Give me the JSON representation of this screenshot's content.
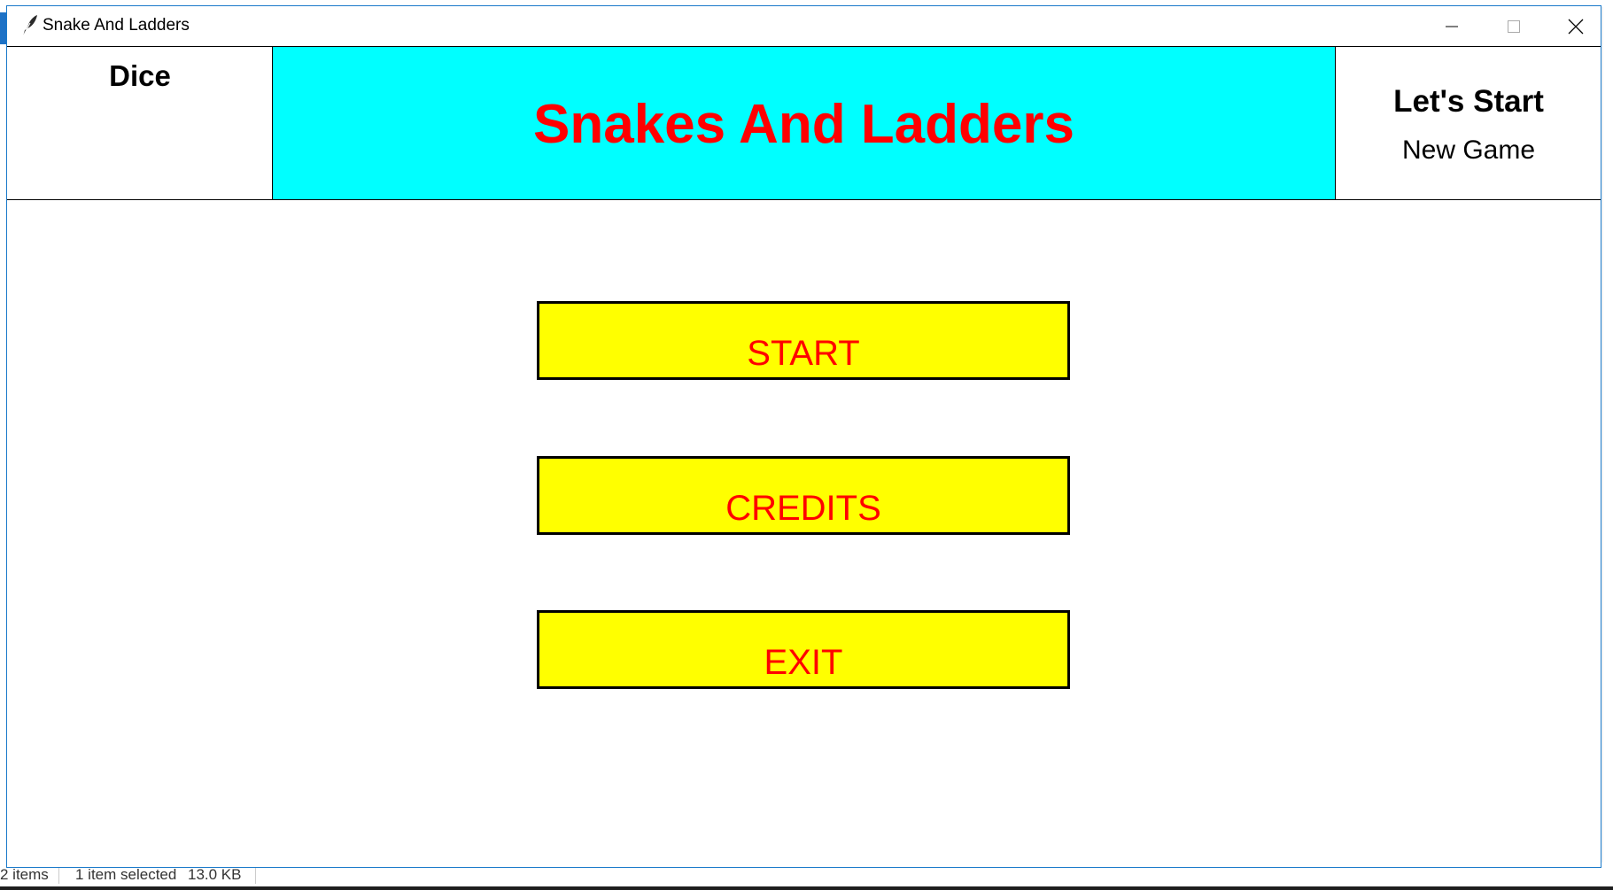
{
  "window": {
    "title": "Snake And Ladders"
  },
  "header": {
    "dice_label": "Dice",
    "game_title": "Snakes And Ladders",
    "lets_start": "Let's Start",
    "new_game": "New Game"
  },
  "menu": {
    "start_label": "START",
    "credits_label": "CREDITS",
    "exit_label": "EXIT"
  },
  "statusbar": {
    "items": "2 items",
    "selected": "1 item selected",
    "size": "13.0 KB"
  },
  "colors": {
    "title_panel_bg": "#00ffff",
    "title_text": "#ff0000",
    "button_bg": "#ffff00",
    "button_text": "#ff0000"
  }
}
